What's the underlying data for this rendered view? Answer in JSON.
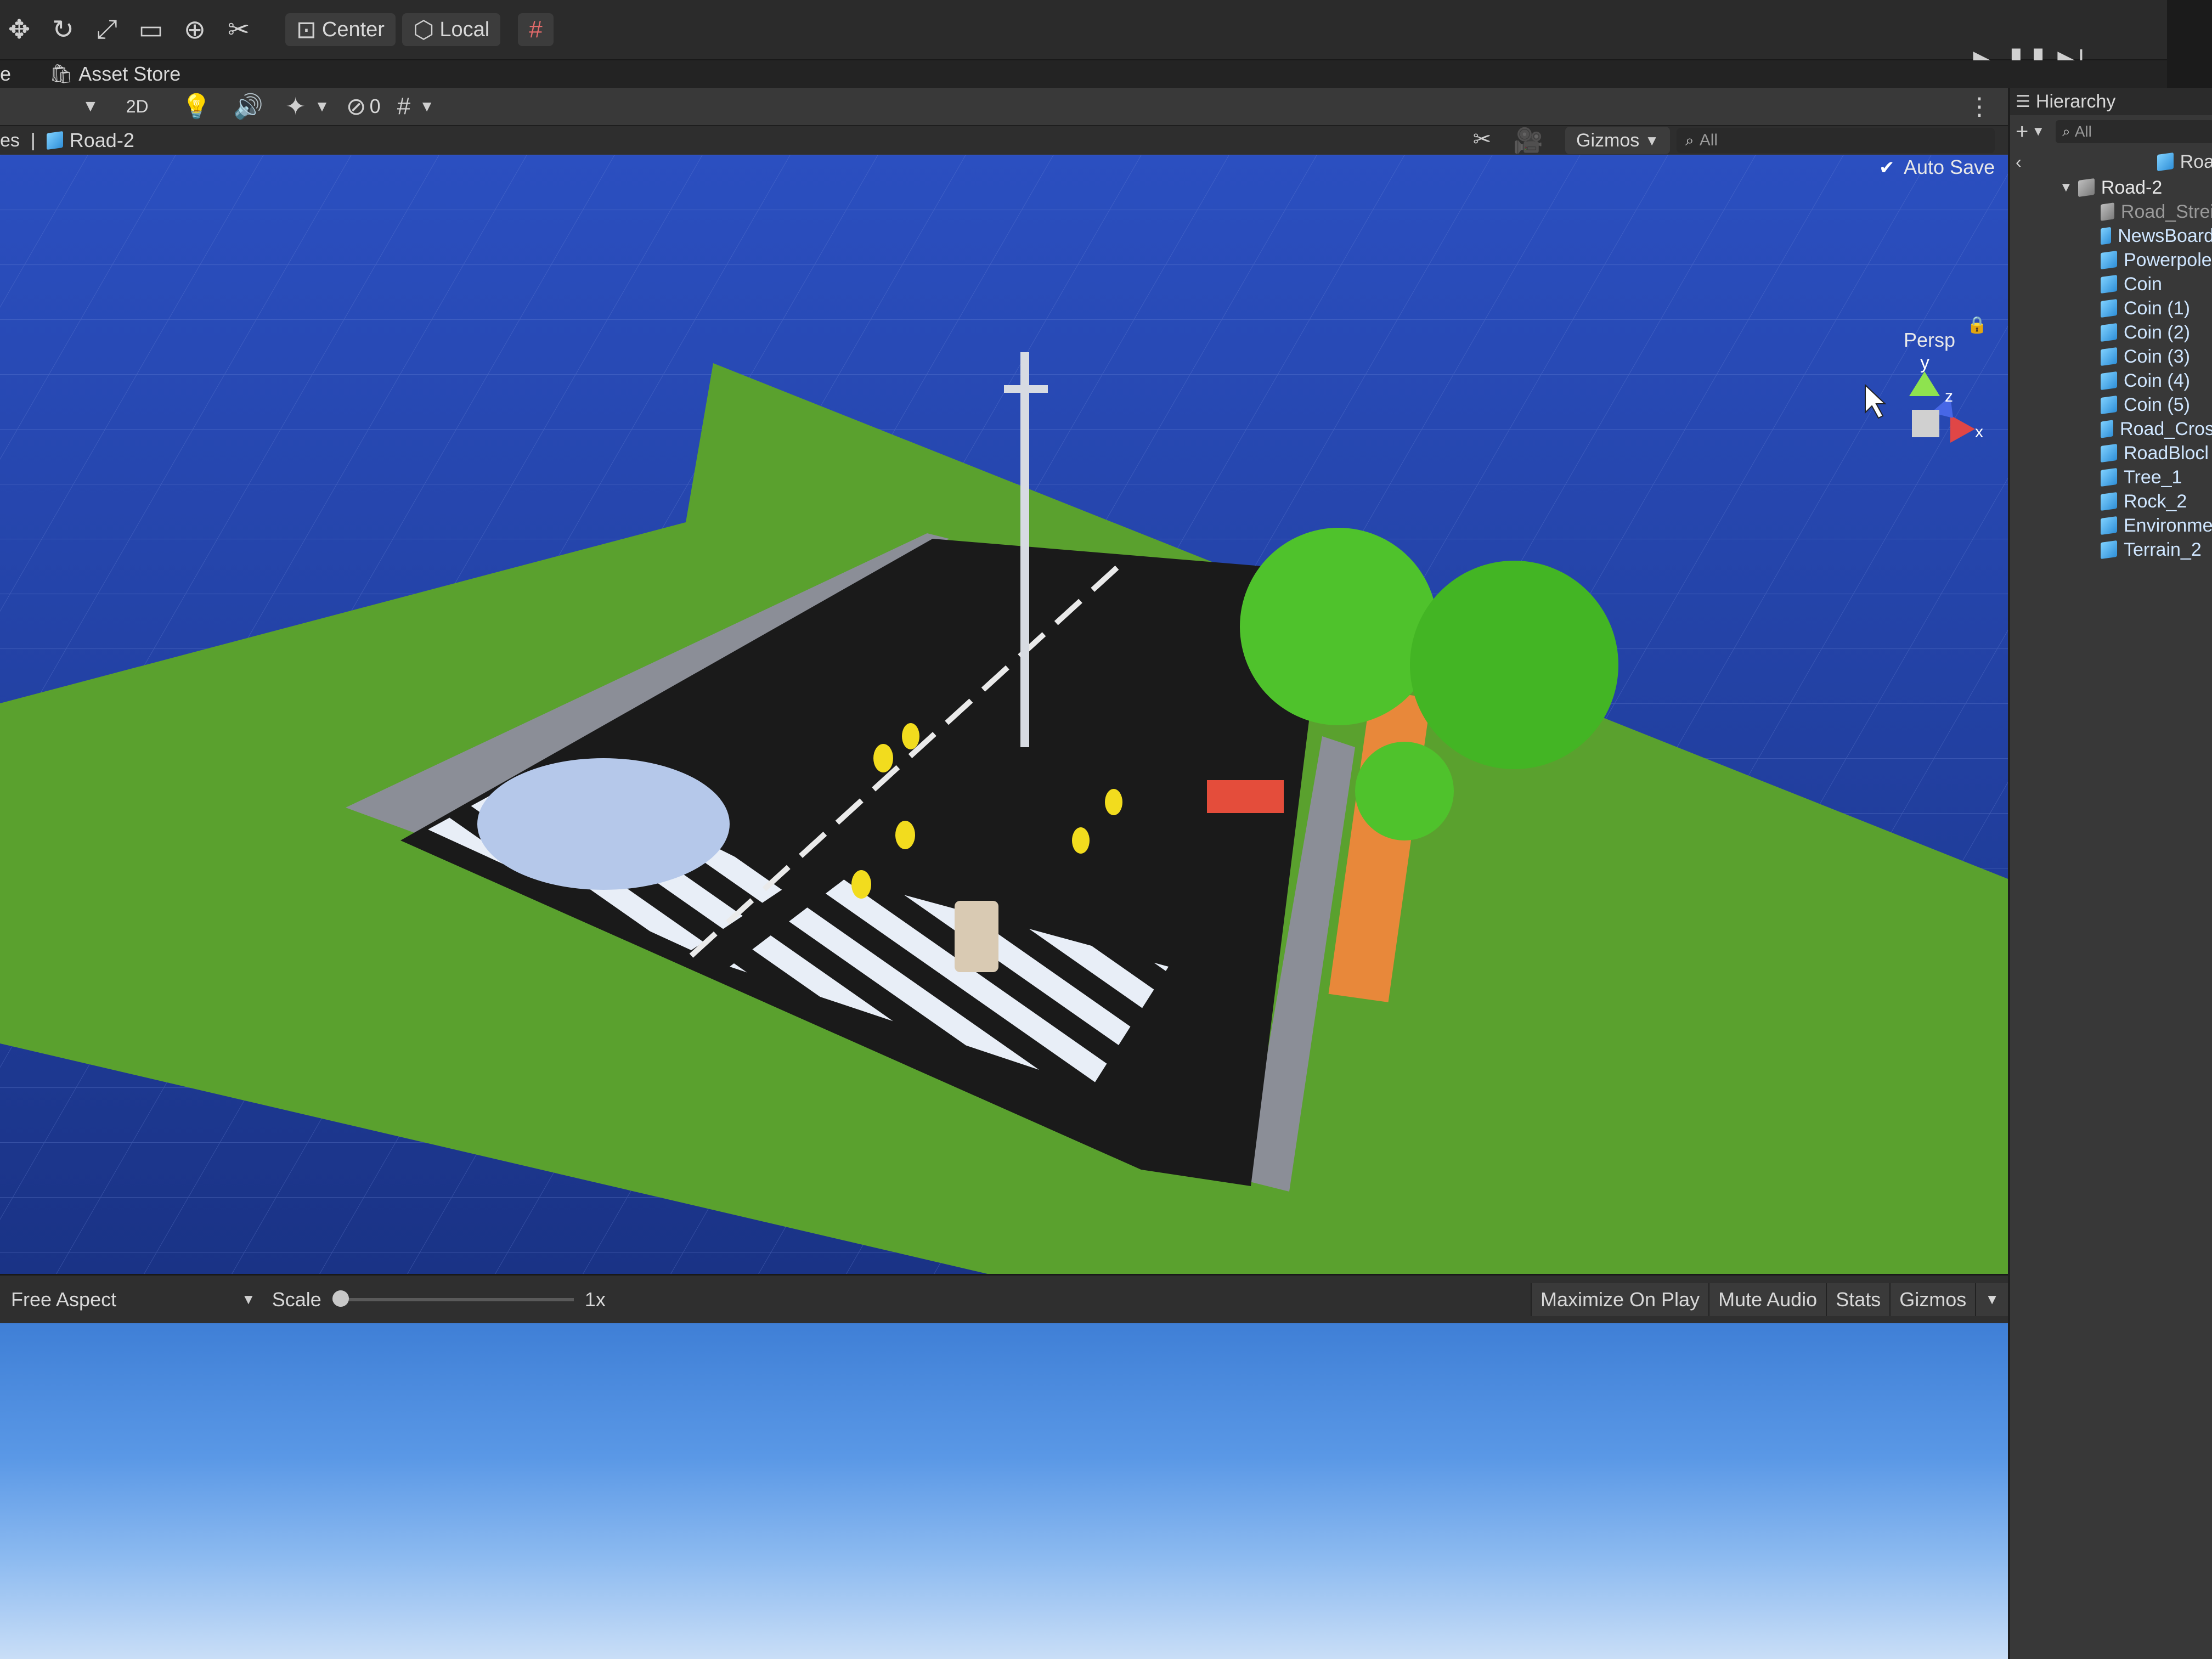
{
  "toolbar": {
    "pivot_label": "Center",
    "space_label": "Local"
  },
  "tabs": {
    "asset_store": "Asset Store"
  },
  "scene_toolbar": {
    "mode_2d": "2D",
    "hidden_count": "0",
    "gizmos_label": "Gizmos",
    "search_placeholder": "All"
  },
  "breadcrumb": {
    "prefix": "es",
    "current": "Road-2",
    "auto_save_label": "Auto Save",
    "auto_save_checked": true
  },
  "scene_view": {
    "axis_y": "y",
    "axis_z": "z",
    "axis_x": "x",
    "projection_label": "Persp"
  },
  "game_view": {
    "aspect_label": "Free Aspect",
    "scale_label": "Scale",
    "scale_value": "1x",
    "maximize_label": "Maximize On Play",
    "mute_label": "Mute Audio",
    "stats_label": "Stats",
    "gizmos_label": "Gizmos"
  },
  "hierarchy": {
    "title": "Hierarchy",
    "search_placeholder": "All",
    "scene_header": "Roa",
    "root": "Road-2",
    "items": [
      {
        "label": "Road_Strei",
        "gray": true
      },
      {
        "label": "NewsBoard"
      },
      {
        "label": "Powerpole"
      },
      {
        "label": "Coin"
      },
      {
        "label": "Coin (1)"
      },
      {
        "label": "Coin (2)"
      },
      {
        "label": "Coin (3)"
      },
      {
        "label": "Coin (4)"
      },
      {
        "label": "Coin (5)"
      },
      {
        "label": "Road_Cros"
      },
      {
        "label": "RoadBlocl"
      },
      {
        "label": "Tree_1"
      },
      {
        "label": "Rock_2"
      },
      {
        "label": "Environme"
      },
      {
        "label": "Terrain_2"
      }
    ]
  },
  "colors": {
    "sky": "#1f3f9e",
    "grass": "#5aa12e",
    "road": "#1a1a1a",
    "tree_leaf": "#4fc22c",
    "tree_trunk": "#e8883a",
    "coin": "#f2dc1e"
  }
}
